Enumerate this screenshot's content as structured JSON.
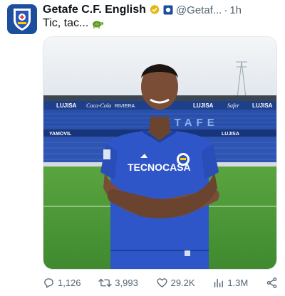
{
  "tweet": {
    "display_name": "Getafe C.F. English",
    "handle": "@Getaf...",
    "separator": "·",
    "time": "1h",
    "text": "Tic, tac...",
    "emoji_icon": "turtle-icon"
  },
  "media": {
    "stadium_ads": [
      "LUJISA",
      "Coca-Cola",
      "RIVIERA",
      "LUJISA",
      "Safer",
      "LUJISA",
      "YAMOVIL",
      "LUJISA"
    ],
    "shirt_sponsor": "TECNOCASA",
    "stand_letters": "GETAFE",
    "colors": {
      "sky": "#e9edf2",
      "seats": "#2a4fa8",
      "grass": "#4f9a3c",
      "shirt": "#2f56c9"
    }
  },
  "actions": {
    "replies": "1,126",
    "retweets": "3,993",
    "likes": "29.2K",
    "views": "1.3M"
  },
  "colors": {
    "brand_blue": "#1d4e9e",
    "verified_gold": "#e2b719",
    "muted": "#536471"
  }
}
